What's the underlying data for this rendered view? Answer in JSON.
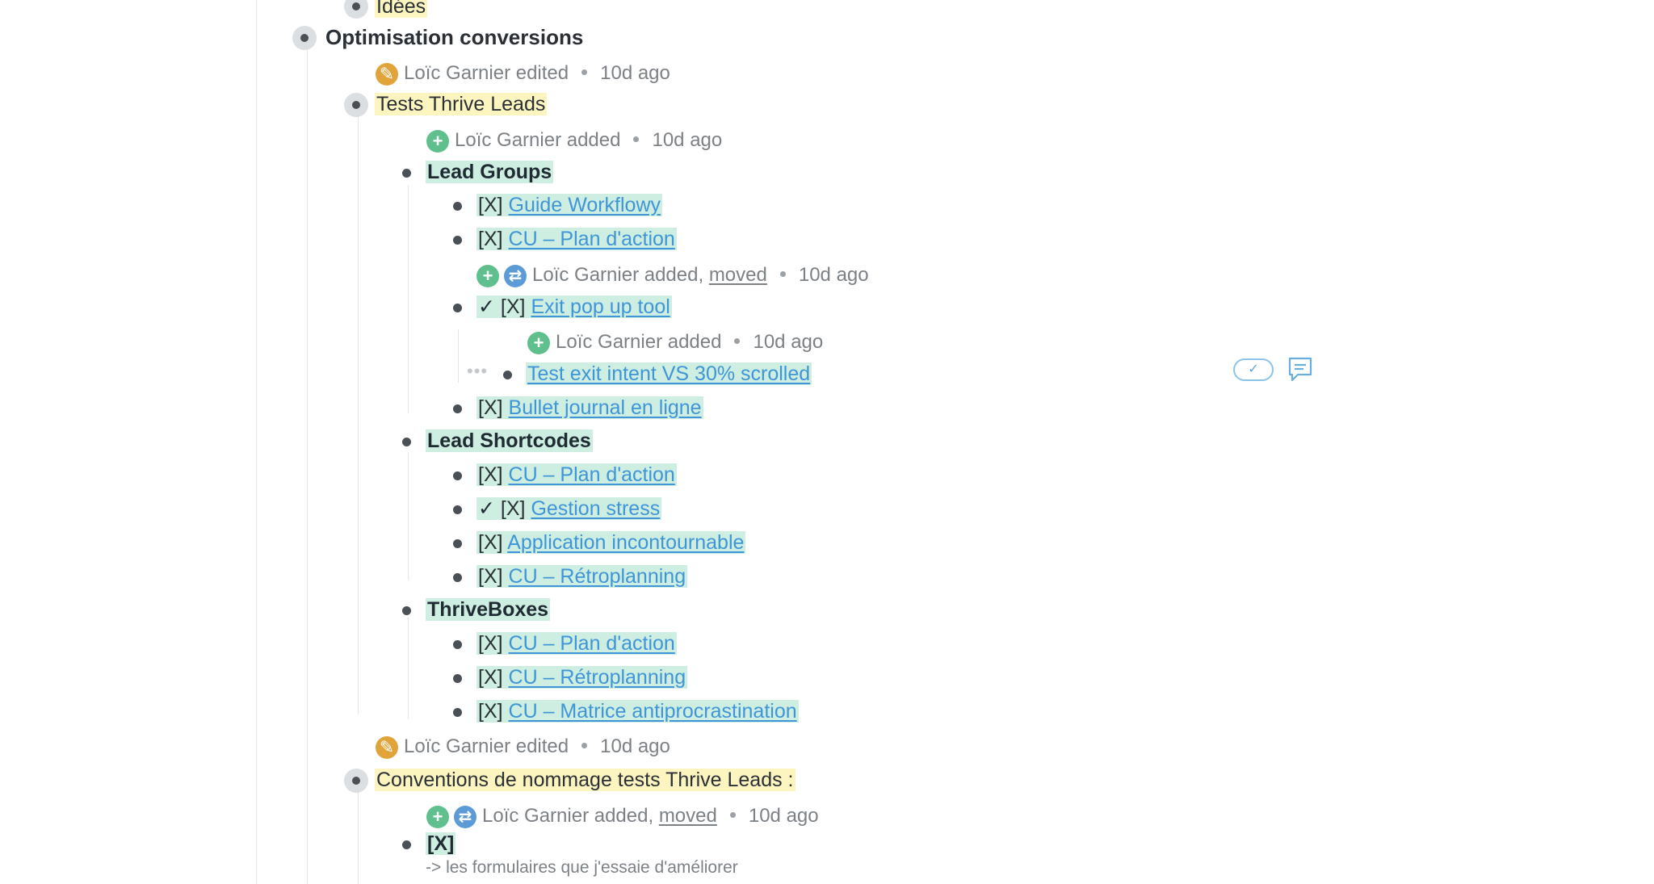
{
  "top": {
    "partial_label": "Idées"
  },
  "section": {
    "title": "Optimisation conversions"
  },
  "events": {
    "e1": {
      "user": "Loïc Garnier",
      "action": "edited",
      "time": "10d ago"
    },
    "e2": {
      "user": "Loïc Garnier",
      "action": "added",
      "time": "10d ago"
    },
    "e3": {
      "user": "Loïc Garnier",
      "action": "added,",
      "moved": "moved",
      "time": "10d ago"
    },
    "e4": {
      "user": "Loïc Garnier",
      "action": "added",
      "time": "10d ago"
    },
    "e5": {
      "user": "Loïc Garnier",
      "action": "edited",
      "time": "10d ago"
    },
    "e6": {
      "user": "Loïc Garnier",
      "action": "added,",
      "moved": "moved",
      "time": "10d ago"
    }
  },
  "tests_thrive": {
    "title": "Tests Thrive Leads",
    "lead_groups": {
      "title": "Lead Groups",
      "items": [
        {
          "prefix": "[X]",
          "link": "Guide Workflowy"
        },
        {
          "prefix": "[X]",
          "link": "CU – Plan d'action"
        },
        {
          "check": "✓",
          "prefix": "[X]",
          "link": "Exit pop up tool"
        },
        {
          "prefix": "",
          "link": "Test exit intent VS 30% scrolled"
        },
        {
          "prefix": "[X]",
          "link": "Bullet journal en ligne"
        }
      ]
    },
    "lead_shortcodes": {
      "title": "Lead Shortcodes",
      "items": [
        {
          "prefix": "[X]",
          "link": "CU – Plan d'action"
        },
        {
          "check": "✓",
          "prefix": "[X]",
          "link": "Gestion stress"
        },
        {
          "prefix": "[X]",
          "link": "Application incontournable"
        },
        {
          "prefix": "[X]",
          "link": "CU – Rétroplanning"
        }
      ]
    },
    "thriveboxes": {
      "title": "ThriveBoxes",
      "items": [
        {
          "prefix": "[X]",
          "link": "CU – Plan d'action"
        },
        {
          "prefix": "[X]",
          "link": "CU – Rétroplanning"
        },
        {
          "prefix": "[X]",
          "link": "CU – Matrice antiprocrastination"
        }
      ]
    }
  },
  "conventions": {
    "title": "Conventions de nommage tests Thrive Leads :",
    "child_label": "[X]",
    "child_note": "-> les formulaires que j'essaie d'améliorer"
  },
  "icons": {
    "edit": "pencil-icon",
    "add": "plus-icon",
    "move": "swap-arrows-icon",
    "complete": "check-icon",
    "comment": "comment-icon"
  },
  "colors": {
    "link": "#3f95d8",
    "highlight_green": "#cdeee0",
    "highlight_yellow": "#fdf5c0",
    "edit_icon": "#e1a43a",
    "add_icon": "#5fc08e",
    "move_icon": "#5d9bd6"
  }
}
